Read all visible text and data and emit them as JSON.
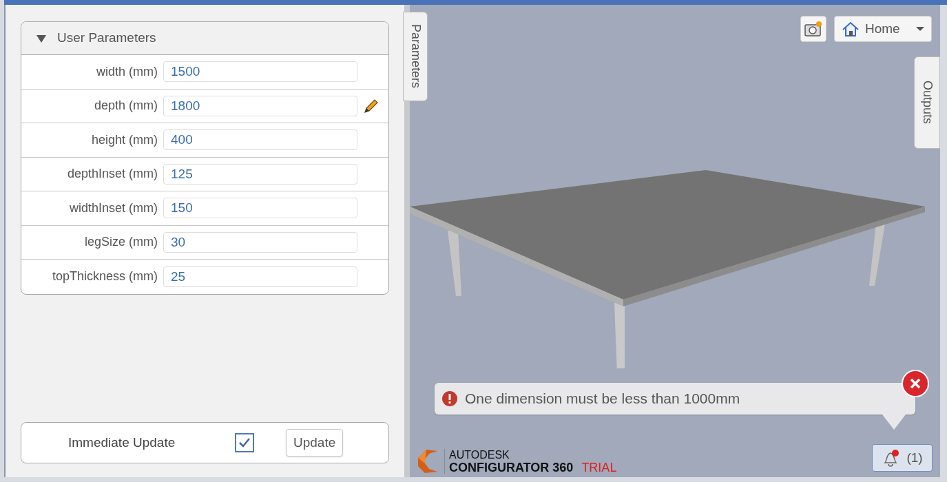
{
  "panel": {
    "title": "User Parameters",
    "expanded": true,
    "parameters": [
      {
        "label": "width (mm)",
        "value": "1500",
        "edited": false
      },
      {
        "label": "depth (mm)",
        "value": "1800",
        "edited": true
      },
      {
        "label": "height (mm)",
        "value": "400",
        "edited": false
      },
      {
        "label": "depthInset (mm)",
        "value": "125",
        "edited": false
      },
      {
        "label": "widthInset (mm)",
        "value": "150",
        "edited": false
      },
      {
        "label": "legSize (mm)",
        "value": "30",
        "edited": false
      },
      {
        "label": "topThickness (mm)",
        "value": "25",
        "edited": false
      }
    ]
  },
  "update_bar": {
    "label": "Immediate Update",
    "checked": true,
    "button": "Update"
  },
  "side_tabs": {
    "left": "Parameters",
    "right": "Outputs"
  },
  "viewer": {
    "view_button": "Home"
  },
  "notification": {
    "message": "One dimension must be less than 1000mm",
    "count": "(1)"
  },
  "branding": {
    "company": "AUTODESK",
    "product": "CONFIGURATOR 360",
    "edition": "TRIAL"
  }
}
